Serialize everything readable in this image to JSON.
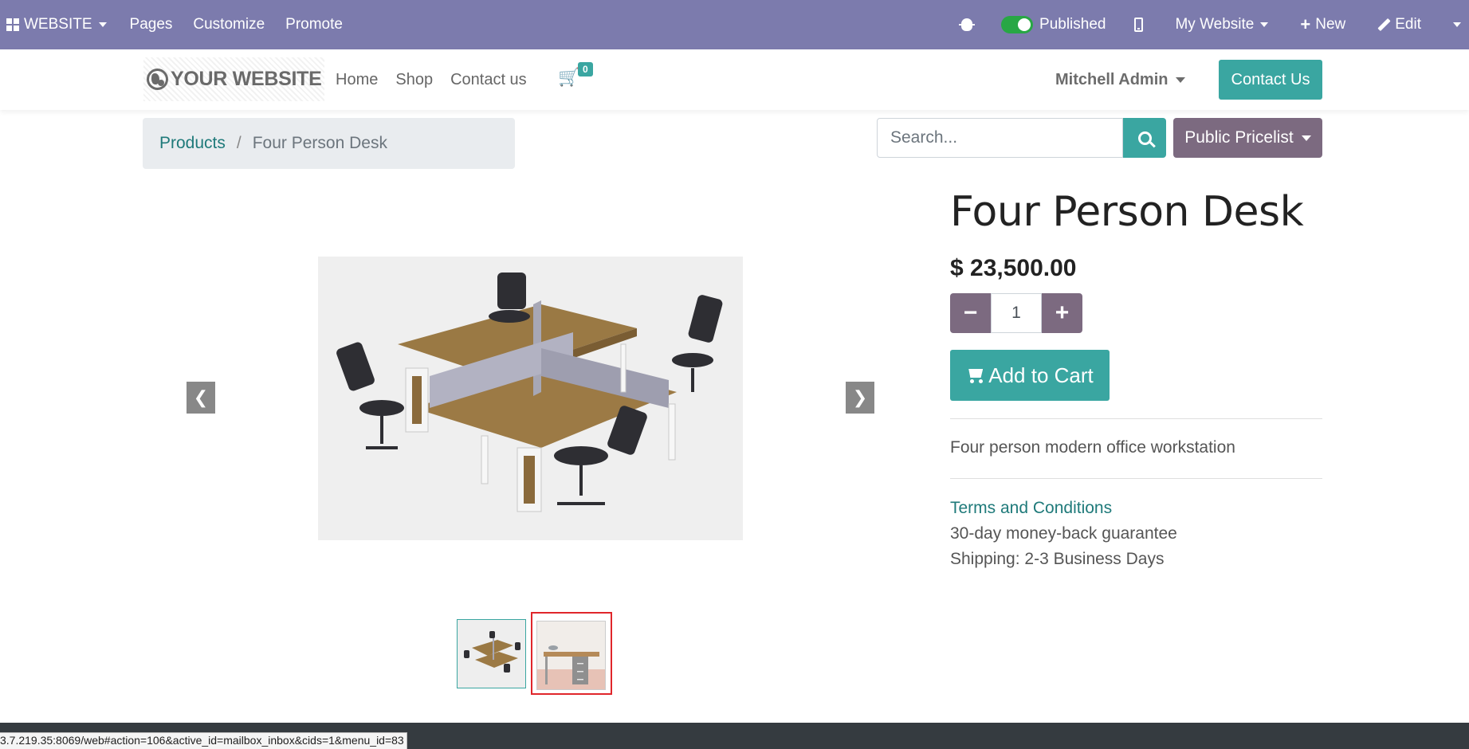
{
  "admin_bar": {
    "website_label": "WEBSITE",
    "pages_label": "Pages",
    "customize_label": "Customize",
    "promote_label": "Promote",
    "published_label": "Published",
    "my_website_label": "My Website",
    "new_label": "New",
    "edit_label": "Edit",
    "bg_color": "#7c7bad"
  },
  "header": {
    "logo_text": "YOUR WEBSITE",
    "nav": [
      "Home",
      "Shop",
      "Contact us"
    ],
    "cart_count": "0",
    "user_name": "Mitchell Admin",
    "contact_button": "Contact Us",
    "accent_color": "#3aa6a1"
  },
  "breadcrumb": {
    "parent": "Products",
    "separator": "/",
    "current": "Four Person Desk"
  },
  "search": {
    "placeholder": "Search..."
  },
  "pricelist": {
    "label": "Public Pricelist",
    "color": "#7c6a80"
  },
  "product": {
    "title": "Four Person Desk",
    "price": "$ 23,500.00",
    "quantity": "1",
    "add_to_cart_label": "Add to Cart",
    "description": "Four person modern office workstation",
    "terms_label": "Terms and Conditions",
    "guarantee": "30-day money-back guarantee",
    "shipping": "Shipping: 2-3 Business Days"
  },
  "status_bar": {
    "url": "3.7.219.35:8069/web#action=106&active_id=mailbox_inbox&cids=1&menu_id=83"
  }
}
